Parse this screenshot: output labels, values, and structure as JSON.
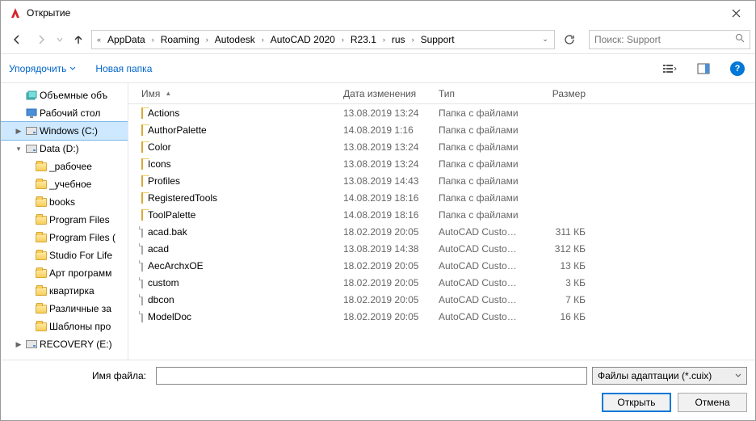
{
  "window": {
    "title": "Открытие"
  },
  "breadcrumb": [
    "AppData",
    "Roaming",
    "Autodesk",
    "AutoCAD 2020",
    "R23.1",
    "rus",
    "Support"
  ],
  "search": {
    "placeholder": "Поиск: Support"
  },
  "toolbar": {
    "organize": "Упорядочить",
    "newfolder": "Новая папка"
  },
  "columns": {
    "name": "Имя",
    "date": "Дата изменения",
    "type": "Тип",
    "size": "Размер"
  },
  "tree": [
    {
      "label": "Объемные объ",
      "icon": "volumes",
      "twist": "",
      "indent": 1
    },
    {
      "label": "Рабочий стол",
      "icon": "desktop",
      "twist": "",
      "indent": 1
    },
    {
      "label": "Windows (C:)",
      "icon": "drive",
      "twist": "▶",
      "indent": 1,
      "selected": true
    },
    {
      "label": "Data (D:)",
      "icon": "drive",
      "twist": "▾",
      "indent": 1
    },
    {
      "label": "_рабочее",
      "icon": "folder",
      "twist": "",
      "indent": 2
    },
    {
      "label": "_учебное",
      "icon": "folder",
      "twist": "",
      "indent": 2
    },
    {
      "label": "books",
      "icon": "folder",
      "twist": "",
      "indent": 2
    },
    {
      "label": "Program Files",
      "icon": "folder",
      "twist": "",
      "indent": 2
    },
    {
      "label": "Program Files (",
      "icon": "folder",
      "twist": "",
      "indent": 2
    },
    {
      "label": "Studio For Life",
      "icon": "folder",
      "twist": "",
      "indent": 2
    },
    {
      "label": "Арт программ",
      "icon": "folder",
      "twist": "",
      "indent": 2
    },
    {
      "label": "квартирка",
      "icon": "folder",
      "twist": "",
      "indent": 2
    },
    {
      "label": "Различные за",
      "icon": "folder",
      "twist": "",
      "indent": 2
    },
    {
      "label": "Шаблоны про",
      "icon": "folder",
      "twist": "",
      "indent": 2
    },
    {
      "label": "RECOVERY (E:)",
      "icon": "drive",
      "twist": "▶",
      "indent": 1
    }
  ],
  "files": [
    {
      "name": "Actions",
      "date": "13.08.2019 13:24",
      "type": "Папка с файлами",
      "size": "",
      "icon": "folder"
    },
    {
      "name": "AuthorPalette",
      "date": "14.08.2019 1:16",
      "type": "Папка с файлами",
      "size": "",
      "icon": "folder"
    },
    {
      "name": "Color",
      "date": "13.08.2019 13:24",
      "type": "Папка с файлами",
      "size": "",
      "icon": "folder"
    },
    {
      "name": "Icons",
      "date": "13.08.2019 13:24",
      "type": "Папка с файлами",
      "size": "",
      "icon": "folder"
    },
    {
      "name": "Profiles",
      "date": "13.08.2019 14:43",
      "type": "Папка с файлами",
      "size": "",
      "icon": "folder"
    },
    {
      "name": "RegisteredTools",
      "date": "14.08.2019 18:16",
      "type": "Папка с файлами",
      "size": "",
      "icon": "folder"
    },
    {
      "name": "ToolPalette",
      "date": "14.08.2019 18:16",
      "type": "Папка с файлами",
      "size": "",
      "icon": "folder"
    },
    {
      "name": "acad.bak",
      "date": "18.02.2019 20:05",
      "type": "AutoCAD Custom...",
      "size": "311 КБ",
      "icon": "file"
    },
    {
      "name": "acad",
      "date": "13.08.2019 14:38",
      "type": "AutoCAD Custom...",
      "size": "312 КБ",
      "icon": "file"
    },
    {
      "name": "AecArchxOE",
      "date": "18.02.2019 20:05",
      "type": "AutoCAD Custom...",
      "size": "13 КБ",
      "icon": "file"
    },
    {
      "name": "custom",
      "date": "18.02.2019 20:05",
      "type": "AutoCAD Custom...",
      "size": "3 КБ",
      "icon": "file"
    },
    {
      "name": "dbcon",
      "date": "18.02.2019 20:05",
      "type": "AutoCAD Custom...",
      "size": "7 КБ",
      "icon": "file"
    },
    {
      "name": "ModelDoc",
      "date": "18.02.2019 20:05",
      "type": "AutoCAD Custom...",
      "size": "16 КБ",
      "icon": "file"
    }
  ],
  "footer": {
    "filename_label": "Имя файла:",
    "filter": "Файлы адаптации (*.cuix)",
    "open": "Открыть",
    "cancel": "Отмена"
  }
}
